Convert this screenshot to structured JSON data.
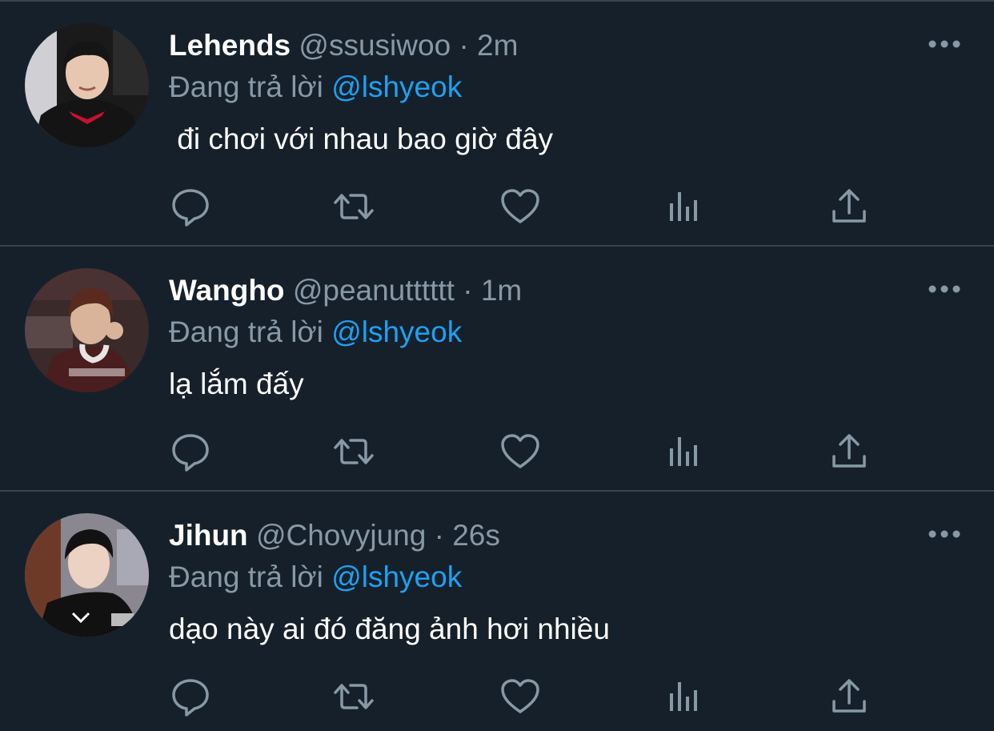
{
  "reply_prefix": "Đang trả lời",
  "colors": {
    "background": "#15202b",
    "divider": "#38444d",
    "primary_text": "#ffffff",
    "secondary_text": "#8899a6",
    "mention": "#1da1f2"
  },
  "action_icons": [
    "reply-icon",
    "retweet-icon",
    "like-icon",
    "analytics-icon",
    "share-icon"
  ],
  "tweets": [
    {
      "name": "Lehends",
      "handle": "@ssusiwoo",
      "separator": "·",
      "time": "2m",
      "reply_to": "@lshyeok",
      "text": " đi chơi với nhau bao giờ đây"
    },
    {
      "name": "Wangho",
      "handle": "@peanutttttt",
      "separator": "·",
      "time": "1m",
      "reply_to": "@lshyeok",
      "text": "lạ lắm đấy"
    },
    {
      "name": "Jihun",
      "handle": "@Chovyjung",
      "separator": "·",
      "time": "26s",
      "reply_to": "@lshyeok",
      "text": "dạo này ai đó đăng ảnh hơi nhiều"
    }
  ]
}
